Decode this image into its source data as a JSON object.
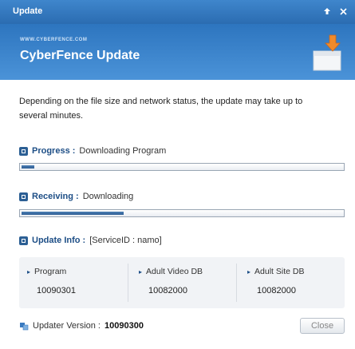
{
  "window": {
    "title": "Update",
    "pin_icon": "pin-icon",
    "close_icon": "close-icon"
  },
  "banner": {
    "small_text": "WWW.CYBERFENCE.COM",
    "title": "CyberFence Update",
    "icon": "package-download-icon"
  },
  "description": "Depending on the file size and network status, the update may take up to several minutes.",
  "progress": {
    "label": "Progress :",
    "value": "Downloading Program",
    "fill": 0.04
  },
  "receiving": {
    "label": "Receiving :",
    "value": "Downloading",
    "fill": 0.32
  },
  "update_info": {
    "label": "Update Info :",
    "value": "[ServiceID : namo]",
    "columns": [
      {
        "name": "Program",
        "version": "10090301"
      },
      {
        "name": "Adult Video DB",
        "version": "10082000"
      },
      {
        "name": "Adult Site DB",
        "version": "10082000"
      }
    ]
  },
  "updater": {
    "label": "Updater Version :",
    "version": "10090300",
    "icon": "updater-icon"
  },
  "close_button": "Close",
  "colors": {
    "title_bar": "#2b6cb1",
    "banner": "#3a84cd",
    "accent": "#1d4e86"
  }
}
